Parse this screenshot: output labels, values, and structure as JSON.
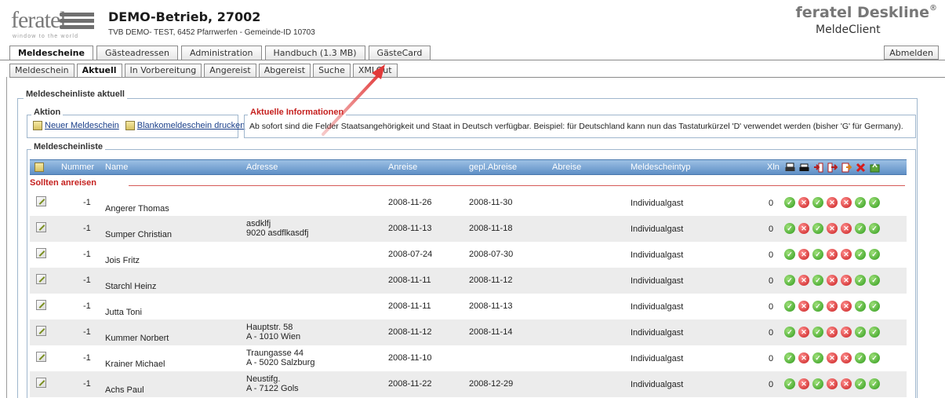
{
  "header": {
    "logo_text": "feratel",
    "logo_tagline": "window to the world",
    "company_name": "DEMO-Betrieb, 27002",
    "company_sub": "TVB DEMO- TEST, 6452 Pfarrwerfen - Gemeinde-ID 10703",
    "brand_title": "feratel Deskline",
    "brand_reg": "®",
    "brand_sub": "MeldeClient"
  },
  "main_tabs": [
    {
      "label": "Meldescheine",
      "active": true
    },
    {
      "label": "Gästeadressen",
      "active": false
    },
    {
      "label": "Administration",
      "active": false
    },
    {
      "label": "Handbuch (1.3 MB)",
      "active": false
    },
    {
      "label": "GästeCard",
      "active": false
    }
  ],
  "logout_label": "Abmelden",
  "sub_tabs": [
    {
      "label": "Meldeschein",
      "active": false
    },
    {
      "label": "Aktuell",
      "active": true
    },
    {
      "label": "In Vorbereitung",
      "active": false
    },
    {
      "label": "Angereist",
      "active": false
    },
    {
      "label": "Abgereist",
      "active": false
    },
    {
      "label": "Suche",
      "active": false
    },
    {
      "label": "XMLOut",
      "active": false
    }
  ],
  "panel": {
    "title": "Meldescheinliste aktuell",
    "aktion_title": "Aktion",
    "aktion_links": [
      "Neuer Meldeschein",
      "Blankomeldeschein drucken"
    ],
    "info_title": "Aktuelle Informationen",
    "info_text": "Ab sofort sind die Felder Staatsangehörigkeit und Staat in Deutsch verfügbar. Beispiel: für Deutschland kann nun das Tastaturkürzel 'D' verwendet werden (bisher 'G' für Germany).",
    "list_title": "Meldescheinliste"
  },
  "table": {
    "headers": {
      "nummer": "Nummer",
      "name": "Name",
      "adresse": "Adresse",
      "anreise": "Anreise",
      "gepl_abreise": "gepl.Abreise",
      "abreise": "Abreise",
      "typ": "Meldescheintyp",
      "xln": "Xln"
    },
    "section_label": "Sollten anreisen",
    "rows": [
      {
        "nummer": "-1",
        "name": "Angerer Thomas",
        "adresse1": "",
        "adresse2": "",
        "anreise": "2008-11-26",
        "gepl_abreise": "2008-11-30",
        "abreise": "",
        "typ": "Individualgast",
        "xln": "0"
      },
      {
        "nummer": "-1",
        "name": "Sumper Christian",
        "adresse1": "asdklfj",
        "adresse2": "9020 asdflkasdfj",
        "anreise": "2008-11-13",
        "gepl_abreise": "2008-11-18",
        "abreise": "",
        "typ": "Individualgast",
        "xln": "0"
      },
      {
        "nummer": "-1",
        "name": "Jois Fritz",
        "adresse1": "",
        "adresse2": "",
        "anreise": "2008-07-24",
        "gepl_abreise": "2008-07-30",
        "abreise": "",
        "typ": "Individualgast",
        "xln": "0"
      },
      {
        "nummer": "-1",
        "name": "Starchl Heinz",
        "adresse1": "",
        "adresse2": "",
        "anreise": "2008-11-11",
        "gepl_abreise": "2008-11-12",
        "abreise": "",
        "typ": "Individualgast",
        "xln": "0"
      },
      {
        "nummer": "-1",
        "name": "Jutta Toni",
        "adresse1": "",
        "adresse2": "",
        "anreise": "2008-11-11",
        "gepl_abreise": "2008-11-13",
        "abreise": "",
        "typ": "Individualgast",
        "xln": "0"
      },
      {
        "nummer": "-1",
        "name": "Kummer Norbert",
        "adresse1": "Hauptstr. 58",
        "adresse2": "A - 1010 Wien",
        "anreise": "2008-11-12",
        "gepl_abreise": "2008-11-14",
        "abreise": "",
        "typ": "Individualgast",
        "xln": "0"
      },
      {
        "nummer": "-1",
        "name": "Krainer Michael",
        "adresse1": "Traungasse 44",
        "adresse2": "A - 5020 Salzburg",
        "anreise": "2008-11-10",
        "gepl_abreise": "",
        "abreise": "",
        "typ": "Individualgast",
        "xln": "0"
      },
      {
        "nummer": "-1",
        "name": "Achs Paul",
        "adresse1": "Neustifg.",
        "adresse2": "A - 7122 Gols",
        "anreise": "2008-11-22",
        "gepl_abreise": "2008-12-29",
        "abreise": "",
        "typ": "Individualgast",
        "xln": "0"
      }
    ],
    "status_pattern": [
      "ok",
      "no",
      "ok",
      "no",
      "no",
      "ok",
      "ok"
    ]
  },
  "colors": {
    "header_blue": "#5f8fc6",
    "alert_red": "#c5211f",
    "ok_green": "#2f9a1b",
    "no_red": "#c81d1d"
  }
}
